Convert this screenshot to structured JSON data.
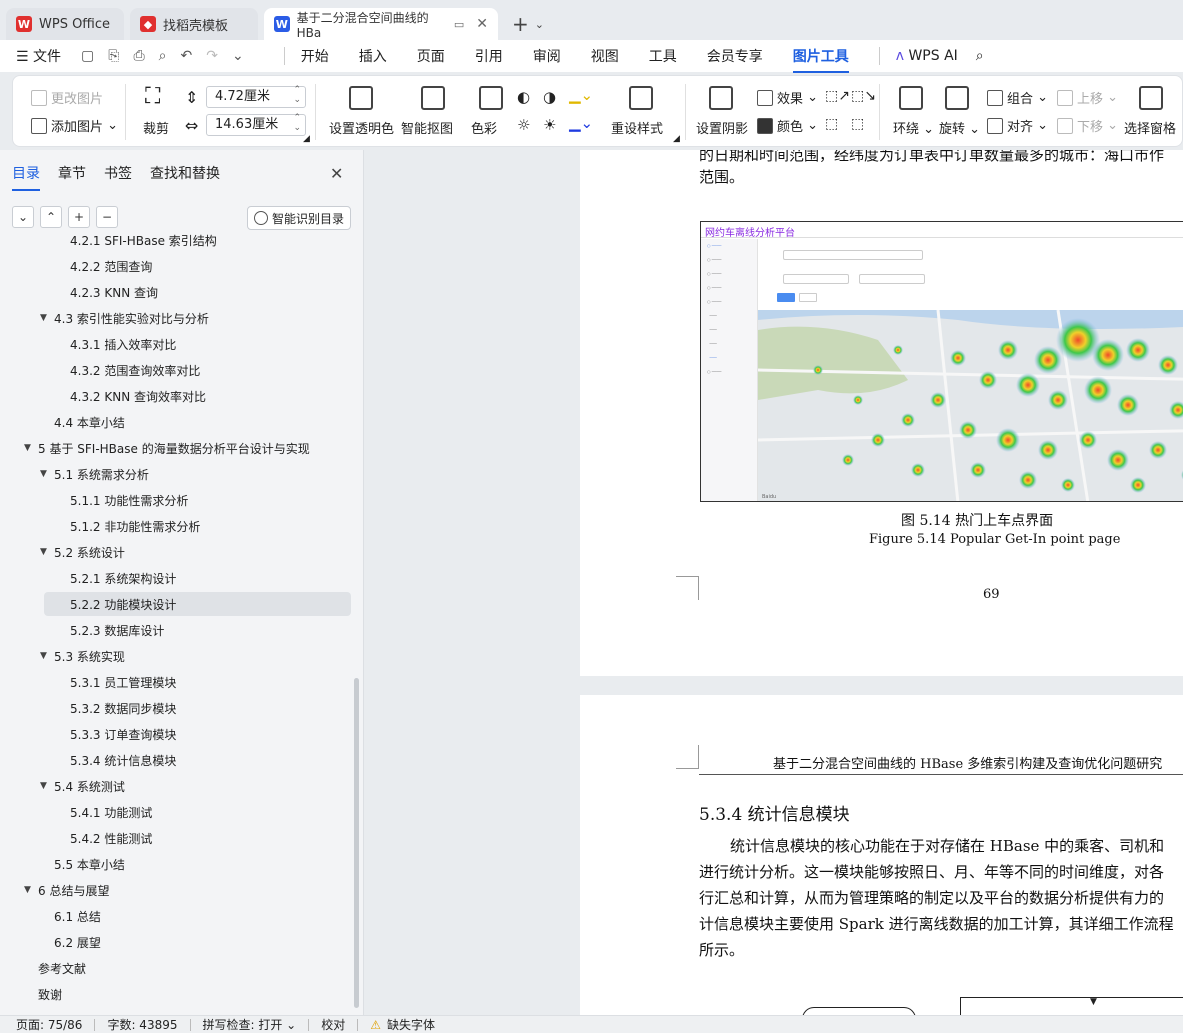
{
  "titlebar": {
    "tabs": [
      {
        "label": "WPS Office",
        "color": "#e0302f"
      },
      {
        "label": "找稻壳模板",
        "color": "#e0302f"
      },
      {
        "label": "基于二分混合空间曲线的HBa",
        "color": "#2b5ce6"
      }
    ]
  },
  "menubar": {
    "file": "文件",
    "items": [
      "开始",
      "插入",
      "页面",
      "引用",
      "审阅",
      "视图",
      "工具",
      "会员专享",
      "图片工具"
    ],
    "wps_ai": "WPS AI"
  },
  "ribbon": {
    "change_picture": "更改图片",
    "add_picture": "添加图片",
    "crop": "裁剪",
    "height_value": "4.72厘米",
    "width_value": "14.63厘米",
    "transparent": "设置透明色",
    "smart_cutout": "智能抠图",
    "color": "色彩",
    "reset_style": "重设样式",
    "shadow": "设置阴影",
    "effect": "效果",
    "fill_color": "颜色",
    "wrap": "环绕",
    "rotate": "旋转",
    "group": "组合",
    "align": "对齐",
    "move_up": "上移",
    "move_down": "下移",
    "select_pane": "选择窗格"
  },
  "sidebar": {
    "tabs": [
      "目录",
      "章节",
      "书签",
      "查找和替换"
    ],
    "smart_toc": "智能识别目录",
    "toc": [
      {
        "label": "4.2.1 SFI-HBase 索引结构",
        "level": 3
      },
      {
        "label": "4.2.2 范围查询",
        "level": 3
      },
      {
        "label": "4.2.3 KNN 查询",
        "level": 3
      },
      {
        "label": "4.3 索引性能实验对比与分析",
        "level": 2,
        "expand": true
      },
      {
        "label": "4.3.1 插入效率对比",
        "level": 3
      },
      {
        "label": "4.3.2 范围查询效率对比",
        "level": 3
      },
      {
        "label": "4.3.2 KNN 查询效率对比",
        "level": 3
      },
      {
        "label": "4.4 本章小结",
        "level": 2
      },
      {
        "label": "5 基于 SFI-HBase 的海量数据分析平台设计与实现",
        "level": 1,
        "expand": true
      },
      {
        "label": "5.1 系统需求分析",
        "level": 2,
        "expand": true
      },
      {
        "label": "5.1.1 功能性需求分析",
        "level": 3
      },
      {
        "label": "5.1.2 非功能性需求分析",
        "level": 3
      },
      {
        "label": "5.2 系统设计",
        "level": 2,
        "expand": true
      },
      {
        "label": "5.2.1 系统架构设计",
        "level": 3
      },
      {
        "label": "5.2.2 功能模块设计",
        "level": 3,
        "selected": true
      },
      {
        "label": "5.2.3 数据库设计",
        "level": 3
      },
      {
        "label": "5.3 系统实现",
        "level": 2,
        "expand": true
      },
      {
        "label": "5.3.1 员工管理模块",
        "level": 3
      },
      {
        "label": "5.3.2 数据同步模块",
        "level": 3
      },
      {
        "label": "5.3.3 订单查询模块",
        "level": 3
      },
      {
        "label": "5.3.4 统计信息模块",
        "level": 3
      },
      {
        "label": "5.4 系统测试",
        "level": 2,
        "expand": true
      },
      {
        "label": "5.4.1 功能测试",
        "level": 3
      },
      {
        "label": "5.4.2 性能测试",
        "level": 3
      },
      {
        "label": "5.5 本章小结",
        "level": 2
      },
      {
        "label": "6 总结与展望",
        "level": 1,
        "expand": true
      },
      {
        "label": "6.1 总结",
        "level": 2
      },
      {
        "label": "6.2 展望",
        "level": 2
      },
      {
        "label": "参考文献",
        "level": 1
      },
      {
        "label": "致谢",
        "level": 1
      }
    ]
  },
  "document": {
    "page1_line1": "的日期和时间范围，经纬度为订单表中订单数量最多的城市：海口市作",
    "page1_line2": "范围。",
    "embedded_title": "网约车离线分析平台",
    "caption_cn": "图 5.14  热门上车点界面",
    "caption_en": "Figure 5.14 Popular Get-In point page",
    "page_number": "69",
    "header": "基于二分混合空间曲线的 HBase 多维索引构建及查询优化问题研究",
    "section_title": "5.3.4  统计信息模块",
    "para": [
      "统计信息模块的核心功能在于对存储在 HBase 中的乘客、司机和",
      "进行统计分析。这一模块能够按照日、月、年等不同的时间维度，对各",
      "行汇总和计算，从而为管理策略的制定以及平台的数据分析提供有力的",
      "计信息模块主要使用 Spark 进行离线数据的加工计算，其详细工作流程",
      "所示。"
    ]
  },
  "statusbar": {
    "page": "页面: 75/86",
    "words": "字数: 43895",
    "spell": "拼写检查: 打开",
    "proof": "校对",
    "missing_font": "缺失字体"
  }
}
